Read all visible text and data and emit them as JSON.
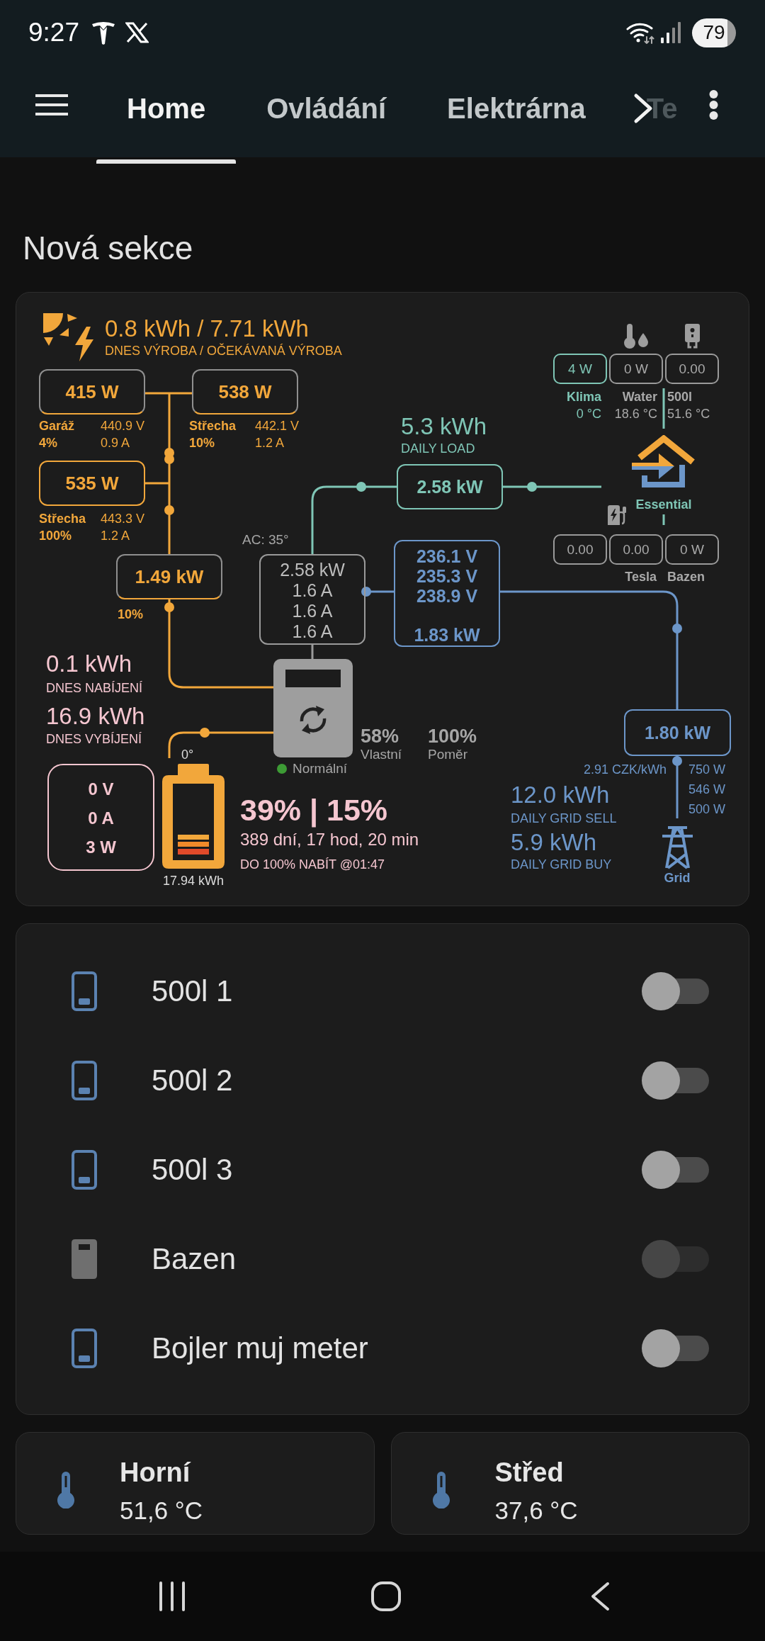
{
  "status_bar": {
    "time": "9:27",
    "battery": "79"
  },
  "tabs": [
    {
      "label": "Home",
      "selected": true
    },
    {
      "label": "Ovládání",
      "selected": false
    },
    {
      "label": "Elektrárna",
      "selected": false
    },
    {
      "label": "Te",
      "selected": false
    }
  ],
  "section_title": "Nová sekce",
  "power_flow": {
    "solar": {
      "energy": "0.8 kWh / 7.71 kWh",
      "energy_label": "DNES VÝROBA / OČEKÁVANÁ VÝROBA",
      "strings": [
        {
          "power": "415 W",
          "name": "Garáž",
          "share": "4%",
          "voltage": "440.9 V",
          "current": "0.9 A",
          "highlighted": false
        },
        {
          "power": "538 W",
          "name": "Střecha",
          "share": "10%",
          "voltage": "442.1 V",
          "current": "1.2 A",
          "highlighted": false
        },
        {
          "power": "535 W",
          "name": "Střecha",
          "share": "100%",
          "voltage": "443.3 V",
          "current": "1.2 A",
          "highlighted": true
        }
      ],
      "total_power": "1.49 kW",
      "total_share": "10%"
    },
    "inverter": {
      "ac_temperature": "AC: 35°",
      "ac_values": [
        "2.58 kW",
        "1.6 A",
        "1.6 A",
        "1.6 A"
      ],
      "status": {
        "label": "Normální",
        "color": "#3d9b35"
      },
      "stats": [
        {
          "value": "58%",
          "label": "Vlastní"
        },
        {
          "value": "100%",
          "label": "Poměr"
        }
      ]
    },
    "load": {
      "energy": "5.3 kWh",
      "energy_label": "DAILY LOAD",
      "power": "2.58 kW",
      "label": "Essential",
      "top_loads": [
        {
          "power": "4 W",
          "name": "Klima",
          "temperature": "0 °C",
          "active": true
        },
        {
          "power": "0 W",
          "name": "Water",
          "temperature": "18.6 °C",
          "active": false
        },
        {
          "power": "0.00",
          "name": "500l",
          "temperature": "51.6 °C",
          "active": false
        }
      ],
      "bottom_loads": [
        {
          "power": "0.00"
        },
        {
          "power": "0.00",
          "name": "Tesla"
        },
        {
          "power": "0 W",
          "name": "Bazen"
        }
      ]
    },
    "grid_voltage": {
      "voltages": [
        "236.1 V",
        "235.3 V",
        "238.9 V"
      ],
      "power": "1.83 kW"
    },
    "grid": {
      "power": "1.80 kW",
      "price": "2.91 CZK/kWh",
      "phases": [
        "750 W",
        "546 W",
        "500 W"
      ],
      "label": "Grid",
      "sell": "12.0 kWh",
      "sell_label": "DAILY GRID SELL",
      "buy": "5.9 kWh",
      "buy_label": "DAILY GRID BUY"
    },
    "battery": {
      "charged_today": "0.1 kWh",
      "charged_label": "DNES NABÍJENÍ",
      "discharged_today": "16.9 kWh",
      "discharged_label": "DNES VYBÍJENÍ",
      "temperature": "0°",
      "readings": [
        "0 V",
        "0 A",
        "3 W"
      ],
      "capacity": "17.94 kWh",
      "soc": "39% | 15%",
      "runtime": "389 dní, 17 hod, 20 min",
      "charge_eta": "DO 100% NABÍT @01:47"
    }
  },
  "switches": [
    {
      "name": "500l 1",
      "on": false,
      "unavailable": false
    },
    {
      "name": "500l 2",
      "on": false,
      "unavailable": false
    },
    {
      "name": "500l 3",
      "on": false,
      "unavailable": false
    },
    {
      "name": "Bazen",
      "on": false,
      "unavailable": true
    },
    {
      "name": "Bojler muj meter",
      "on": false,
      "unavailable": false
    }
  ],
  "sensors": [
    {
      "name": "Horní",
      "value": "51,6 °C"
    },
    {
      "name": "Střed",
      "value": "37,6 °C"
    }
  ]
}
